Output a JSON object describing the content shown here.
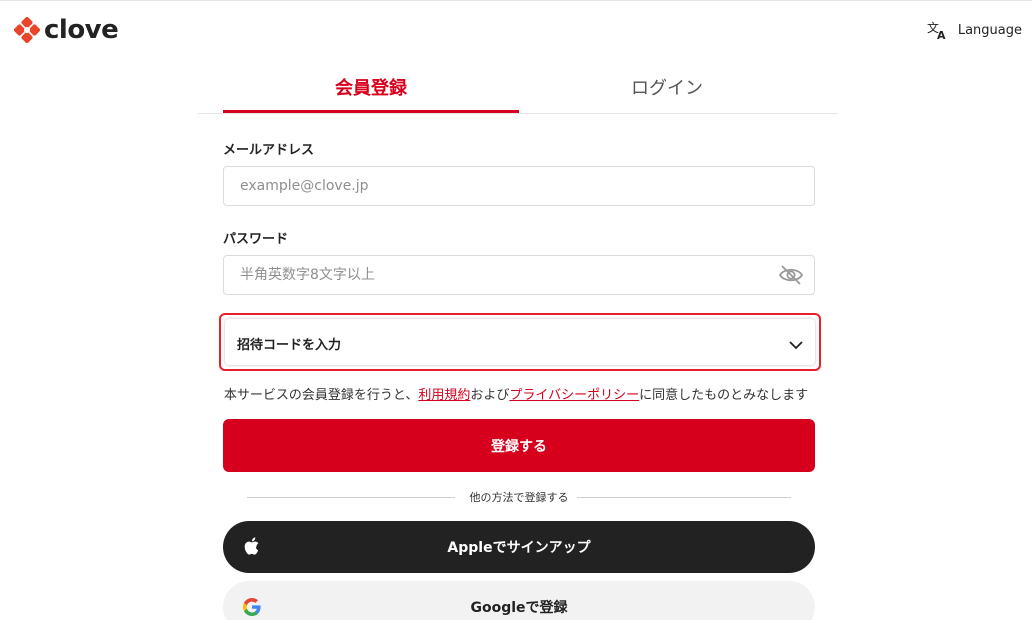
{
  "header": {
    "logo_text": "clove",
    "language_label": "Language",
    "brand_color": "#e8452c"
  },
  "tabs": {
    "register": "会員登録",
    "login": "ログイン",
    "active": "register"
  },
  "form": {
    "email_label": "メールアドレス",
    "email_placeholder": "example@clove.jp",
    "email_value": "",
    "password_label": "パスワード",
    "password_placeholder": "半角英数字8文字以上",
    "password_value": "",
    "invite_code_label": "招待コードを入力",
    "terms_prefix": "本サービスの会員登録を行うと、",
    "terms_link": "利用規約",
    "terms_middle": "および",
    "privacy_link": "プライバシーポリシー",
    "terms_suffix": "に同意したものとみなします",
    "submit_label": "登録する",
    "divider_text": "他の方法で登録する",
    "apple_label": "Appleでサインアップ",
    "google_label": "Googleで登録"
  },
  "icons": {
    "logo": "clove-logo-icon",
    "language": "translate-icon",
    "password_toggle": "eye-off-icon",
    "invite_toggle": "chevron-down-icon",
    "apple": "apple-icon",
    "google": "google-icon"
  },
  "colors": {
    "accent": "#d6001c",
    "highlight_border": "#e8202a",
    "apple_button": "#222222",
    "google_button": "#f2f2f2"
  }
}
